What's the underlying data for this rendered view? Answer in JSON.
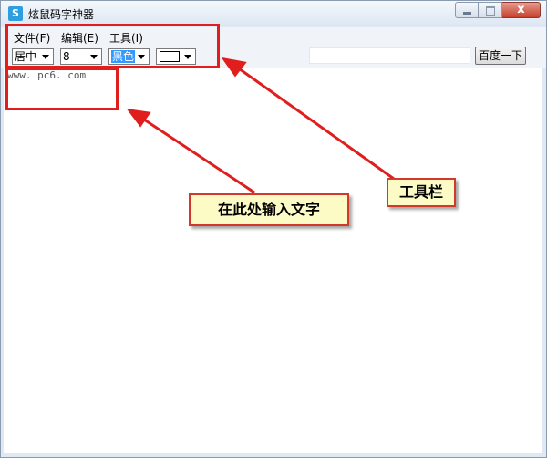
{
  "window": {
    "title": "炫鼠码字神器",
    "app_icon_letter": "S",
    "close_glyph": "x"
  },
  "menu": {
    "items": [
      "文件(F)",
      "编辑(E)",
      "工具(I)"
    ]
  },
  "toolbar": {
    "align_value": "居中",
    "size_value": "8",
    "color_value": "黑色",
    "search_value": "",
    "search_button_label": "百度一下"
  },
  "editor": {
    "text": "www. pc6. com"
  },
  "annotations": {
    "input_hint": "在此处输入文字",
    "toolbar_hint": "工具栏",
    "accent_color": "#e01e1e",
    "callout_bg": "#fdfbc5"
  }
}
